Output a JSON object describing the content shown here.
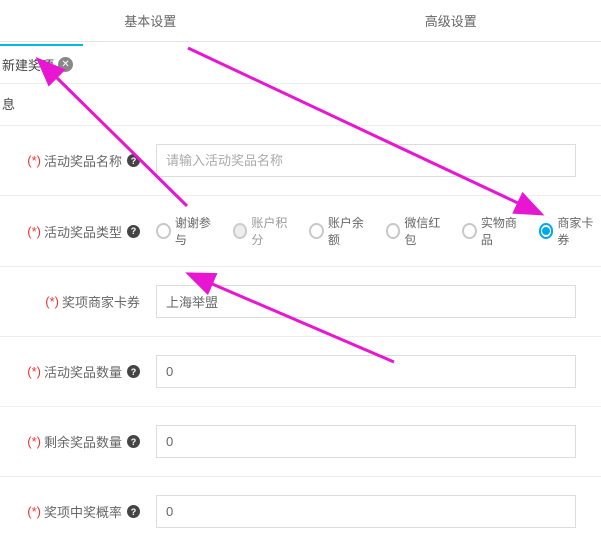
{
  "tabs": {
    "basic": "基本设置",
    "advanced": "高级设置"
  },
  "subTab": {
    "label": "新建奖项",
    "close": "✕"
  },
  "sectionPartial": "息",
  "form": {
    "prizeName": {
      "req": "(*)",
      "label": "活动奖品名称",
      "placeholder": "请输入活动奖品名称"
    },
    "prizeType": {
      "req": "(*)",
      "label": "活动奖品类型",
      "options": {
        "thanks": "谢谢参与",
        "points": "账户积分",
        "balance": "账户余额",
        "wechat": "微信红包",
        "physical": "实物商品",
        "coupon": "商家卡券"
      }
    },
    "coupon": {
      "req": "(*)",
      "label": "奖项商家卡券",
      "value": "上海举盟"
    },
    "prizeQty": {
      "req": "(*)",
      "label": "活动奖品数量",
      "value": "0"
    },
    "remainQty": {
      "req": "(*)",
      "label": "剩余奖品数量",
      "value": "0"
    },
    "winRate": {
      "req": "(*)",
      "label": "奖项中奖概率",
      "value": "0"
    }
  },
  "helpGlyph": "?"
}
